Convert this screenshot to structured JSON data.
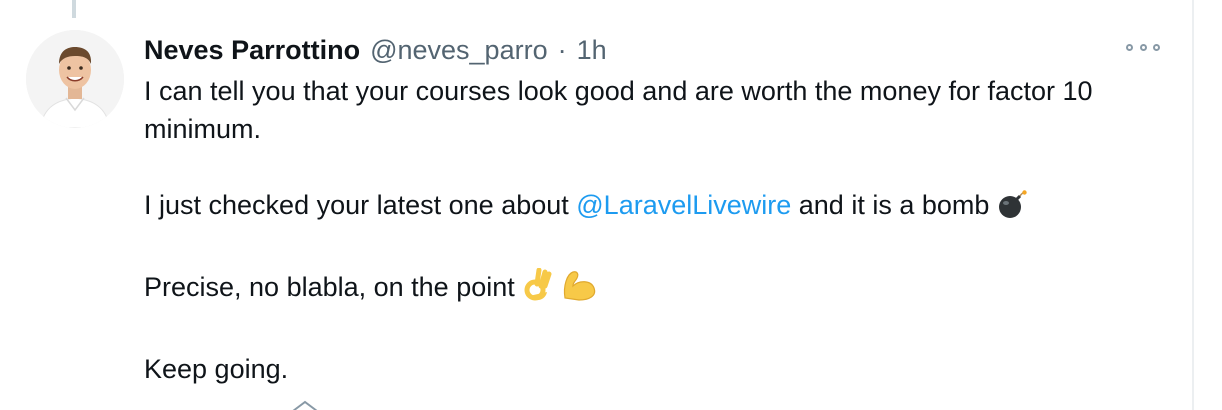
{
  "tweet": {
    "author": {
      "display_name": "Neves Parrottino",
      "handle": "@neves_parro"
    },
    "separator": "·",
    "time": "1h",
    "text": {
      "line1": "I can tell you that your courses look good and are worth the money for factor 10 minimum.",
      "line2_prefix": "I just checked your latest one about ",
      "line2_mention": "@LaravelLivewire",
      "line2_suffix": " and it is a bomb",
      "line3": "Precise, no blabla, on the point",
      "line4": "Keep going."
    },
    "emojis": [
      "bomb-emoji",
      "ok-hand-emoji",
      "flexed-biceps-emoji"
    ],
    "colors": {
      "link": "#1d9bf0",
      "text": "#0f1419",
      "muted": "#536471",
      "emoji_yellow": "#f7c948"
    }
  }
}
